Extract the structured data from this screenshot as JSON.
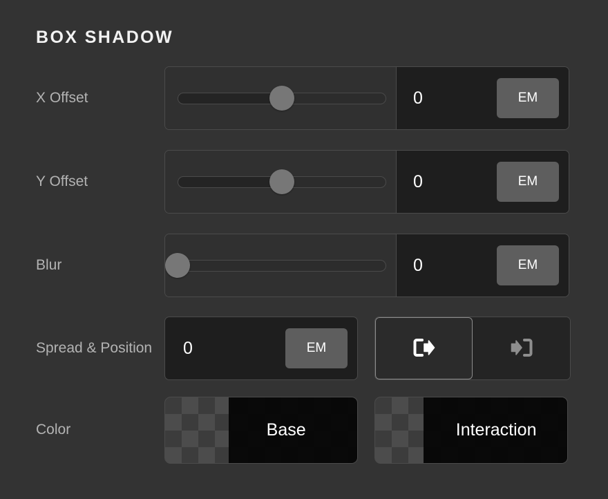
{
  "panel": {
    "title": "BOX SHADOW",
    "background_color": "#333333",
    "accent_color": "#5e5e5e"
  },
  "rows": {
    "x_offset": {
      "label": "X Offset",
      "value": "0",
      "unit": "EM",
      "slider_percent": 50
    },
    "y_offset": {
      "label": "Y Offset",
      "value": "0",
      "unit": "EM",
      "slider_percent": 50
    },
    "blur": {
      "label": "Blur",
      "value": "0",
      "unit": "EM",
      "slider_percent": 0
    },
    "spread": {
      "label": "Spread & Position",
      "value": "0",
      "unit": "EM",
      "position_outset": {
        "icon": "arrow-out-of-bracket-icon",
        "selected": true
      },
      "position_inset": {
        "icon": "arrow-into-bracket-icon",
        "selected": false
      }
    },
    "color": {
      "label": "Color",
      "base": {
        "label": "Base",
        "swatch_color": "#050505"
      },
      "interaction": {
        "label": "Interaction",
        "swatch_color": "#050505"
      }
    }
  }
}
